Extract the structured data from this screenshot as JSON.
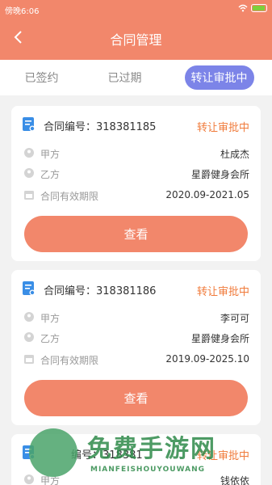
{
  "status_bar": {
    "time": "傍晚6:06"
  },
  "nav": {
    "title": "合同管理"
  },
  "tabs": [
    "已签约",
    "已过期",
    "转让审批中"
  ],
  "cards": [
    {
      "contract_no": "合同编号：318381185",
      "status": "转让审批中",
      "party_a_label": "甲方",
      "party_a": "杜成杰",
      "party_b_label": "乙方",
      "party_b": "星爵健身会所",
      "period_label": "合同有效期限",
      "period": "2020.09-2021.05",
      "button": "查看"
    },
    {
      "contract_no": "合同编号：318381186",
      "status": "转让审批中",
      "party_a_label": "甲方",
      "party_a": "李可可",
      "party_b_label": "乙方",
      "party_b": "星爵健身会所",
      "period_label": "合同有效期限",
      "period": "2019.09-2025.10",
      "button": "查看"
    },
    {
      "contract_no": "编号：318381",
      "status": "转让审批中",
      "party_a_label": "甲方",
      "party_a": "钱依依"
    }
  ],
  "watermark": {
    "title": "免费手游网",
    "subtitle": "MIANFEISHOUYOUWANG"
  },
  "colors": {
    "accent": "#f2876b",
    "tab_active": "#7c84e8",
    "status": "#f07a3a",
    "doc_icon": "#3a8ee6"
  }
}
